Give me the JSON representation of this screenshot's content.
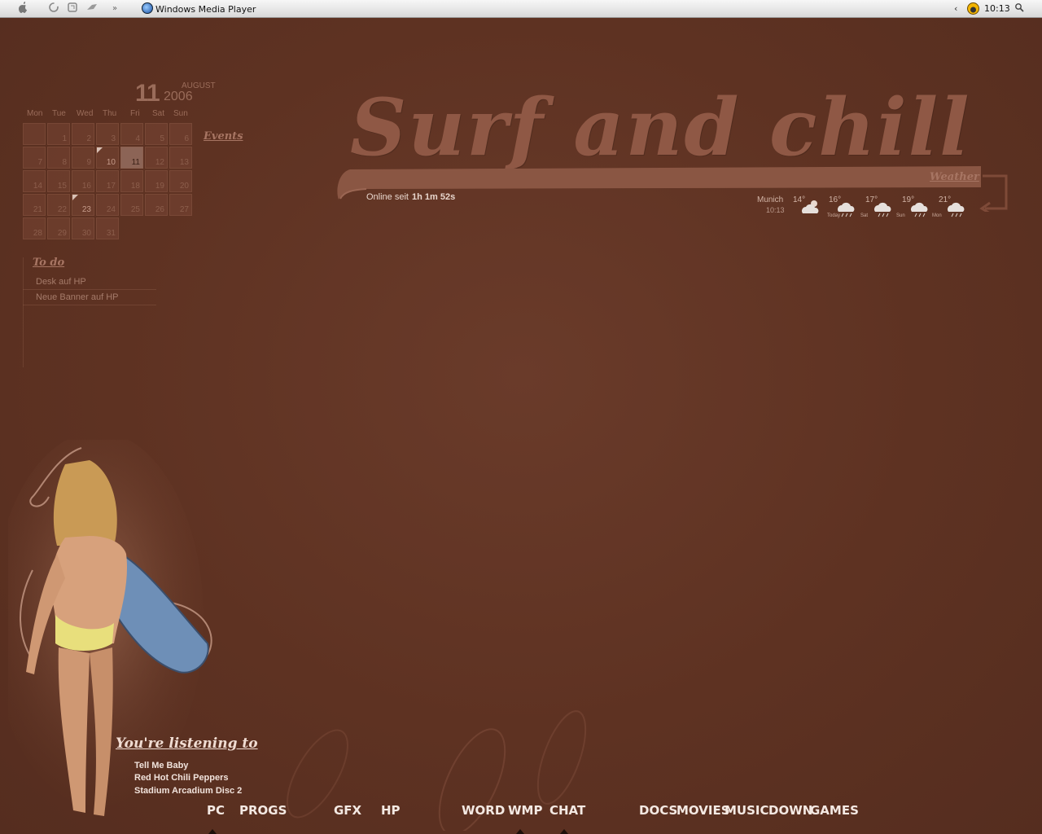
{
  "taskbar": {
    "active_window": "Windows Media Player",
    "clock": "10:13"
  },
  "calendar": {
    "day": "11",
    "year": "2006",
    "month": "AUGUST",
    "weekdays": [
      "Mon",
      "Tue",
      "Wed",
      "Thu",
      "Fri",
      "Sat",
      "Sun"
    ],
    "rows": [
      [
        "",
        "1",
        "2",
        "3",
        "4",
        "5",
        "6"
      ],
      [
        "7",
        "8",
        "9",
        "10",
        "11",
        "12",
        "13"
      ],
      [
        "14",
        "15",
        "16",
        "17",
        "18",
        "19",
        "20"
      ],
      [
        "21",
        "22",
        "23",
        "24",
        "25",
        "26",
        "27"
      ],
      [
        "28",
        "29",
        "30",
        "31",
        "",
        "",
        ""
      ]
    ],
    "events_label": "Events"
  },
  "todo": {
    "title": "To do",
    "items": [
      "Desk auf HP",
      "Neue Banner auf HP"
    ]
  },
  "headline": "Surf and chill",
  "online": {
    "label": "Online seit",
    "value": "1h 1m 52s"
  },
  "weather": {
    "link": "Weather",
    "city": "Munich",
    "time": "10:13",
    "forecast": [
      {
        "temp": "14°",
        "day": "",
        "icon": "partly-sunny-icon"
      },
      {
        "temp": "16°",
        "day": "Today",
        "icon": "rain-cloud-icon"
      },
      {
        "temp": "17°",
        "day": "Sat",
        "icon": "rain-cloud-icon"
      },
      {
        "temp": "19°",
        "day": "Sun",
        "icon": "rain-cloud-icon"
      },
      {
        "temp": "21°",
        "day": "Mon",
        "icon": "rain-cloud-icon"
      }
    ]
  },
  "now_playing": {
    "title": "You're listening to",
    "track": "Tell Me Baby",
    "artist": "Red Hot Chili Peppers",
    "album": "Stadium Arcadium Disc 2"
  },
  "dock": [
    "PC",
    "PROGS",
    "GFX",
    "HP",
    "WORD",
    "WMP",
    "CHAT",
    "DOCS",
    "MOVIES",
    "MUSIC",
    "DOWN",
    "GAMES"
  ],
  "colors": {
    "background": "#5e3222",
    "accent": "#8f5845"
  }
}
